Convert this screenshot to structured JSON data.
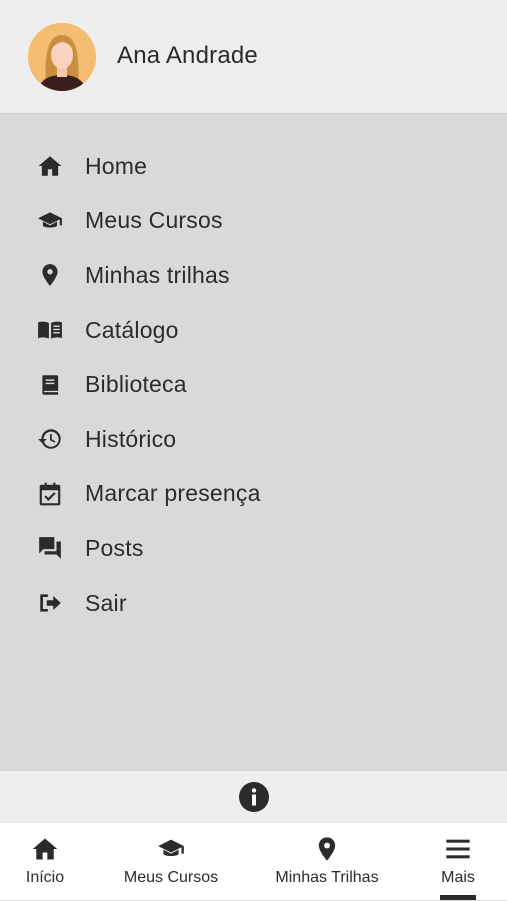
{
  "user": {
    "name": "Ana Andrade",
    "avatar_icon": "user-avatar"
  },
  "menu": {
    "items": [
      {
        "label": "Home",
        "icon": "home-icon"
      },
      {
        "label": "Meus Cursos",
        "icon": "graduation-cap-icon"
      },
      {
        "label": "Minhas trilhas",
        "icon": "map-pin-icon"
      },
      {
        "label": "Catálogo",
        "icon": "open-book-icon"
      },
      {
        "label": "Biblioteca",
        "icon": "book-icon"
      },
      {
        "label": "Histórico",
        "icon": "history-icon"
      },
      {
        "label": "Marcar presença",
        "icon": "calendar-check-icon"
      },
      {
        "label": "Posts",
        "icon": "chat-icon"
      },
      {
        "label": "Sair",
        "icon": "logout-icon"
      }
    ]
  },
  "info": {
    "icon": "info-icon"
  },
  "bottom_nav": {
    "items": [
      {
        "label": "Início",
        "icon": "home-icon"
      },
      {
        "label": "Meus Cursos",
        "icon": "graduation-cap-icon"
      },
      {
        "label": "Minhas Trilhas",
        "icon": "map-pin-icon"
      },
      {
        "label": "Mais",
        "icon": "menu-icon",
        "active": true
      }
    ]
  },
  "colors": {
    "text": "#2b2b2b",
    "header_bg": "#eeeeee",
    "menu_bg": "#d9d9d9",
    "nav_bg": "#ffffff",
    "avatar_bg": "#f4bd72"
  }
}
